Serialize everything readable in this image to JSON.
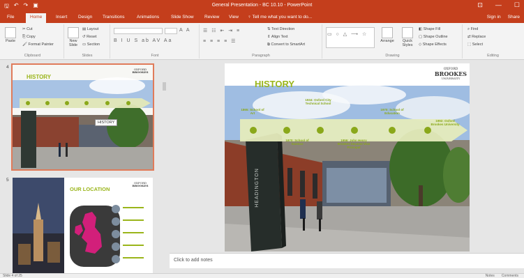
{
  "window": {
    "title": "General Presentation - BC 10.10 - PowerPoint",
    "controls": [
      "⊡",
      "—",
      "☐"
    ]
  },
  "quick_access": [
    "🖫",
    "↶",
    "↷",
    "▣"
  ],
  "tabs": [
    "File",
    "Home",
    "Insert",
    "Design",
    "Transitions",
    "Animations",
    "Slide Show",
    "Review",
    "View"
  ],
  "active_tab": "Home",
  "tell_me": "♀ Tell me what you want to do...",
  "account": {
    "sign_in": "Sign in",
    "share": "Share"
  },
  "ribbon": {
    "clipboard": {
      "label": "Clipboard",
      "paste": "Paste",
      "cut": "Cut",
      "copy": "Copy",
      "format_painter": "Format Painter"
    },
    "slides": {
      "label": "Slides",
      "new_slide": "New Slide",
      "layout": "Layout",
      "reset": "Reset",
      "section": "Section"
    },
    "font": {
      "label": "Font"
    },
    "paragraph": {
      "label": "Paragraph",
      "text_direction": "Text Direction",
      "align_text": "Align Text",
      "convert_smartart": "Convert to SmartArt"
    },
    "drawing": {
      "label": "Drawing",
      "arrange": "Arrange",
      "quick_styles": "Quick Styles",
      "shape_fill": "Shape Fill",
      "shape_outline": "Shape Outline",
      "shape_effects": "Shape Effects"
    },
    "editing": {
      "label": "Editing",
      "find": "Find",
      "replace": "Replace",
      "select": "Select"
    }
  },
  "thumbnails": [
    {
      "num": "4",
      "title": "HISTORY",
      "tooltip": "HISTORY"
    },
    {
      "num": "5",
      "title": "OUR LOCATION"
    }
  ],
  "slide": {
    "title": "HISTORY",
    "brand_line1": "OXFORD",
    "brand_line2": "BROOKES",
    "brand_line3": "UNIVERSITY",
    "sign_text": "HEADINGTON",
    "milestones_top": [
      "1865: School of Art",
      "1934: Oxford City Technical School",
      "1970: School of Education",
      "1992: Oxford Brookes University"
    ],
    "milestones_bottom": [
      "1870: School of Science",
      "1956: John Henry Brookes became Vice Principal"
    ]
  },
  "notes": {
    "placeholder": "Click to add notes"
  },
  "status": {
    "slide_info": "Slide 4 of 25",
    "notes_btn": "Notes",
    "comments_btn": "Comments"
  },
  "colors": {
    "accent": "#c43e1c",
    "slide_title": "#9ab51a",
    "milestone": "#8aa81a"
  }
}
